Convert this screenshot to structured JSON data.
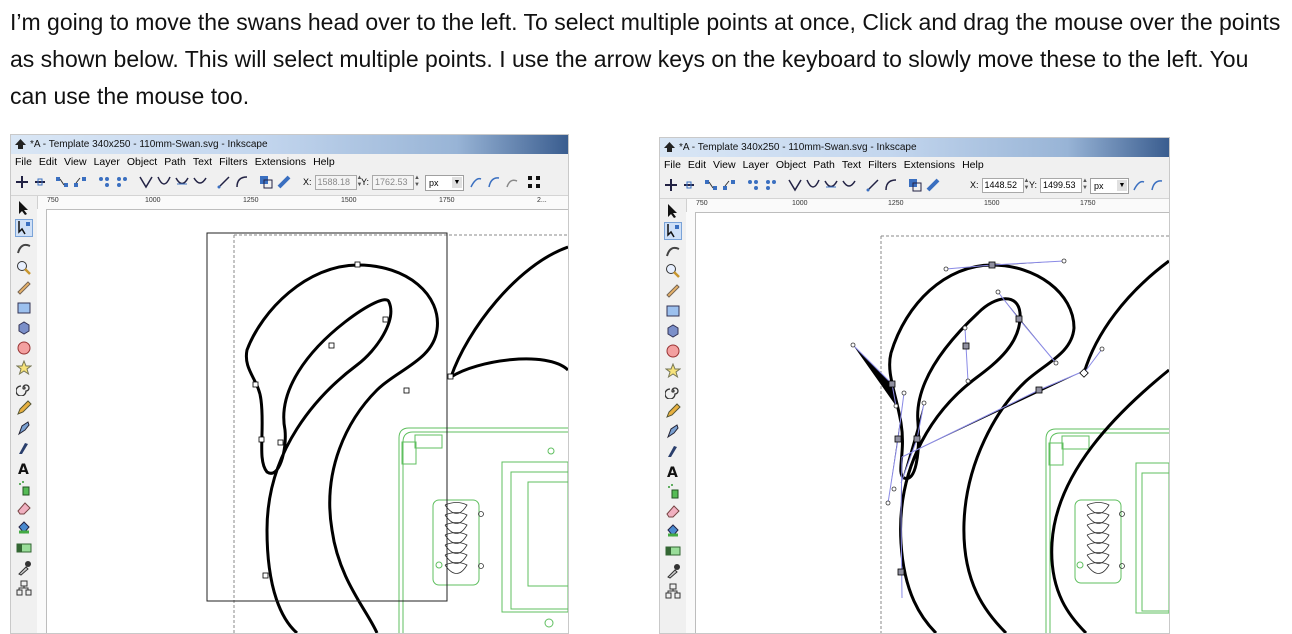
{
  "instruction_text": "I’m going to move the swans head over to the left. To select multiple points at once, Click and drag the mouse over the points as shown below. This will select multiple points. I use the arrow keys on the keyboard to slowly move these to the left. You can use the mouse too.",
  "left_window": {
    "title": "*A - Template 340x250 - 110mm-Swan.svg - Inkscape",
    "menu": [
      "File",
      "Edit",
      "View",
      "Layer",
      "Object",
      "Path",
      "Text",
      "Filters",
      "Extensions",
      "Help"
    ],
    "x_label": "X:",
    "x_value": "1588.18",
    "y_label": "Y:",
    "y_value": "1762.53",
    "unit": "px",
    "ruler_ticks": [
      "750",
      "1000",
      "1250",
      "1500",
      "1750",
      "2..."
    ]
  },
  "right_window": {
    "title": "*A - Template 340x250 - 110mm-Swan.svg - Inkscape",
    "menu": [
      "File",
      "Edit",
      "View",
      "Layer",
      "Object",
      "Path",
      "Text",
      "Filters",
      "Extensions",
      "Help"
    ],
    "x_label": "X:",
    "x_value": "1448.52",
    "y_label": "Y:",
    "y_value": "1499.53",
    "unit": "px",
    "ruler_ticks": [
      "750",
      "1000",
      "1250",
      "1500",
      "1750"
    ]
  },
  "colors": {
    "path_stroke": "#000000",
    "guide_green": "#5fbf5f",
    "handle_line": "#8a8ae6",
    "titlebar_end": "#3a5d8f"
  },
  "icons": [
    "inkscape-logo-icon",
    "selector-tool-icon",
    "node-tool-icon",
    "tweak-tool-icon",
    "zoom-tool-icon",
    "measure-tool-icon",
    "rectangle-tool-icon",
    "3d-box-tool-icon",
    "ellipse-tool-icon",
    "star-tool-icon",
    "spiral-tool-icon",
    "pencil-tool-icon",
    "pen-tool-icon",
    "calligraphy-tool-icon",
    "text-tool-icon",
    "spray-tool-icon",
    "eraser-tool-icon",
    "bucket-tool-icon",
    "gradient-tool-icon",
    "dropper-tool-icon",
    "connector-tool-icon"
  ]
}
